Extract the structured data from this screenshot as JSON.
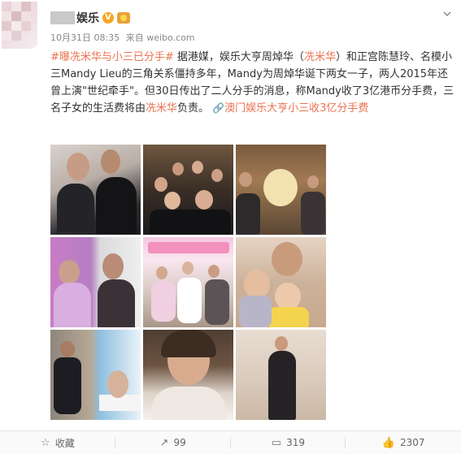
{
  "author": {
    "name_suffix": "娱乐",
    "verified_icon": "v-badge-icon",
    "medal_icon": "medal-icon"
  },
  "meta": {
    "date": "10月31日 08:35",
    "source_prefix": "来自",
    "source": "weibo.com"
  },
  "post": {
    "hashtag": "#曝冼米华与小三已分手#",
    "text1": " 据港媒，娱乐大亨周焯华（",
    "mention1": "冼米华",
    "text2": "）和正宫陈慧玲、名模小三Mandy Lieu的三角关系僵持多年，Mandy为周焯华诞下两女一子，两人2015年还曾上演\"世纪牵手\"。但30日传出了二人分手的消息，称Mandy收了3亿港币分手费，三名子女的生活费将由",
    "mention2": "冼米华",
    "text3": "负责。",
    "link_text": "澳门娱乐大亨小三收3亿分手费"
  },
  "images": [
    {
      "label": "photo-1"
    },
    {
      "label": "photo-2"
    },
    {
      "label": "photo-3"
    },
    {
      "label": "photo-4"
    },
    {
      "label": "photo-5"
    },
    {
      "label": "photo-6"
    },
    {
      "label": "photo-7"
    },
    {
      "label": "photo-8"
    },
    {
      "label": "photo-9"
    }
  ],
  "footer": {
    "favorite_label": "收藏",
    "repost_count": "99",
    "comment_count": "319",
    "like_count": "2307"
  }
}
